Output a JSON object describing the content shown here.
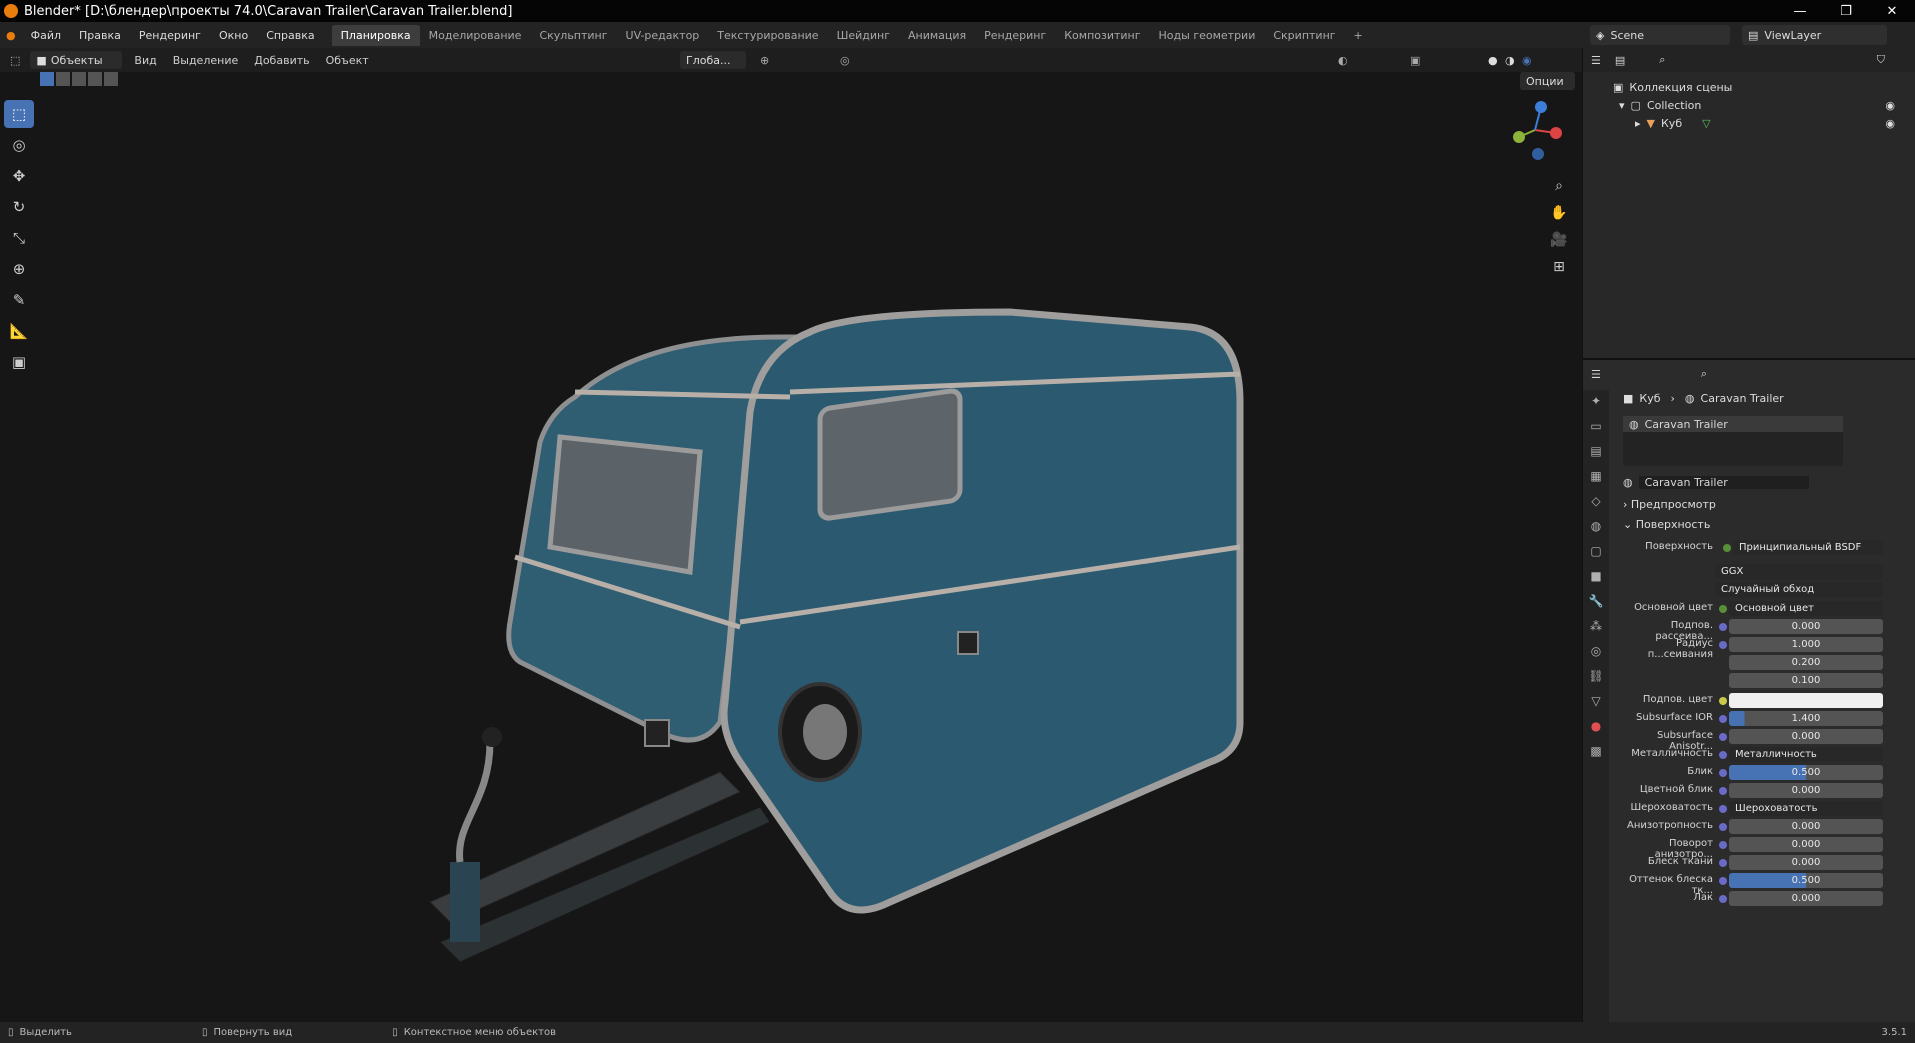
{
  "window": {
    "title": "Blender* [D:\\блендер\\проекты 74.0\\Caravan Trailer\\Caravan Trailer.blend]",
    "minimize": "—",
    "maximize": "❐",
    "close": "✕"
  },
  "menu": [
    "Файл",
    "Правка",
    "Рендеринг",
    "Окно",
    "Справка"
  ],
  "workspaces": [
    "Планировка",
    "Моделирование",
    "Скульптинг",
    "UV-редактор",
    "Текстурирование",
    "Шейдинг",
    "Анимация",
    "Рендеринг",
    "Композитинг",
    "Ноды геометрии",
    "Скриптинг"
  ],
  "workspace_add": "+",
  "scene": "Scene",
  "view_layer": "ViewLayer",
  "vp_header": {
    "mode": "Объекты",
    "items": [
      "Вид",
      "Выделение",
      "Добавить",
      "Объект"
    ],
    "transform": "Глоба...",
    "options": "Опции"
  },
  "outliner": {
    "scene_collection": "Коллекция сцены",
    "collection": "Collection",
    "object": "Куб"
  },
  "props": {
    "breadcrumb_object": "Куб",
    "breadcrumb_material": "Caravan Trailer",
    "slot": "Caravan Trailer",
    "material_name": "Caravan Trailer",
    "sections": {
      "preview": "Предпросмотр",
      "surface": "Поверхность"
    },
    "surface_label": "Поверхность",
    "surface_value": "Принципиальный BSDF",
    "dist": "GGX",
    "subsurface_method": "Случайный обход",
    "rows": [
      {
        "label": "Основной цвет",
        "value": "Основной цвет",
        "kind": "link"
      },
      {
        "label": "Подпов. рассеива...",
        "value": "0.000",
        "kind": "num"
      },
      {
        "label": "Радиус п...сеивания",
        "value": "1.000",
        "kind": "num"
      },
      {
        "label": "",
        "value": "0.200",
        "kind": "num"
      },
      {
        "label": "",
        "value": "0.100",
        "kind": "num"
      },
      {
        "label": "Подпов. цвет",
        "value": "",
        "kind": "color"
      },
      {
        "label": "Subsurface IOR",
        "value": "1.400",
        "kind": "num"
      },
      {
        "label": "Subsurface Anisotr...",
        "value": "0.000",
        "kind": "num"
      },
      {
        "label": "Металличность",
        "value": "Металличность",
        "kind": "link"
      },
      {
        "label": "Блик",
        "value": "0.500",
        "kind": "blue"
      },
      {
        "label": "Цветной блик",
        "value": "0.000",
        "kind": "num"
      },
      {
        "label": "Шероховатость",
        "value": "Шероховатость",
        "kind": "link"
      },
      {
        "label": "Анизотропность",
        "value": "0.000",
        "kind": "num"
      },
      {
        "label": "Поворот анизотро...",
        "value": "0.000",
        "kind": "num"
      },
      {
        "label": "Блеск ткани",
        "value": "0.000",
        "kind": "num"
      },
      {
        "label": "Оттенок блеска тк...",
        "value": "0.500",
        "kind": "blue"
      },
      {
        "label": "Лак",
        "value": "0.000",
        "kind": "num"
      }
    ]
  },
  "status": {
    "select": "Выделить",
    "rotate": "Повернуть вид",
    "context": "Контекстное меню объектов",
    "version": "3.5.1"
  }
}
